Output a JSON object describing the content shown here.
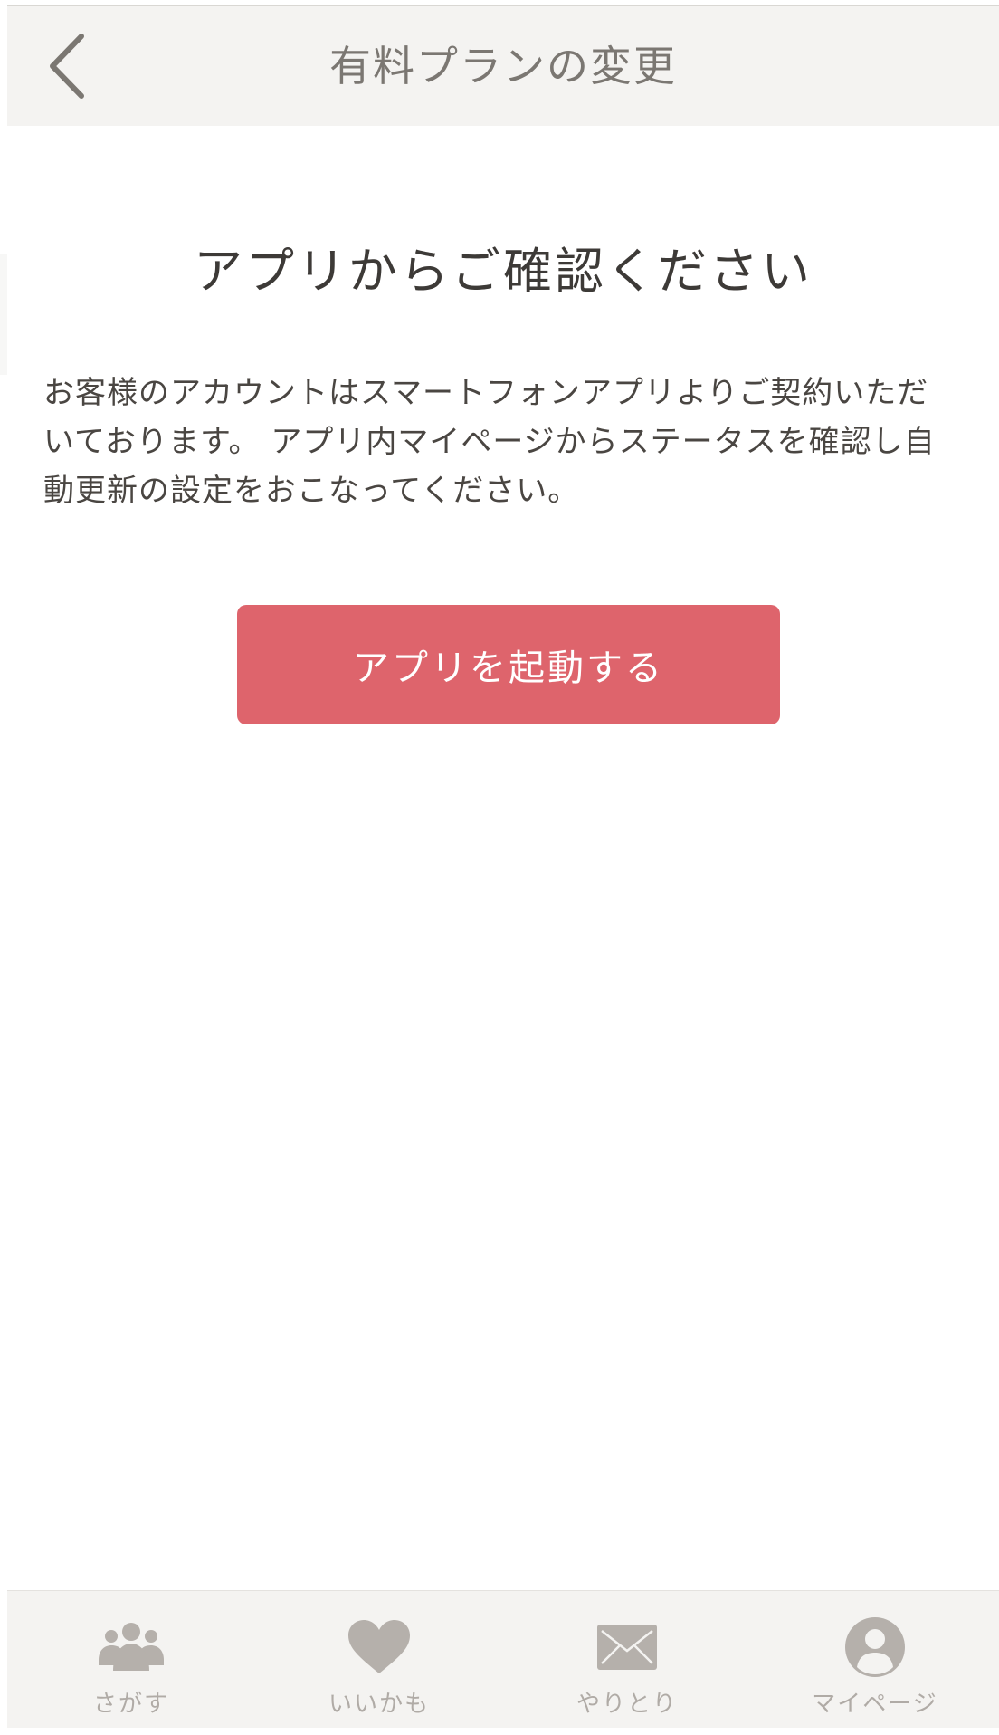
{
  "header": {
    "title": "有料プランの変更",
    "back_icon": "chevron-left-icon"
  },
  "content": {
    "heading": "アプリからご確認ください",
    "body": "お客様のアカウントはスマートフォンアプリよりご契約いただいております。 アプリ内マイページからステータスを確認し自動更新の設定をおこなってください。",
    "button_label": "アプリを起動する"
  },
  "tabbar": {
    "items": [
      {
        "label": "さがす",
        "icon": "people-icon"
      },
      {
        "label": "いいかも",
        "icon": "heart-icon"
      },
      {
        "label": "やりとり",
        "icon": "envelope-icon"
      },
      {
        "label": "マイページ",
        "icon": "user-icon"
      }
    ]
  },
  "colors": {
    "accent": "#de646c",
    "header_bg": "#f4f3f1",
    "tab_icon": "#b5b0ab",
    "title_text": "#7b7772"
  }
}
